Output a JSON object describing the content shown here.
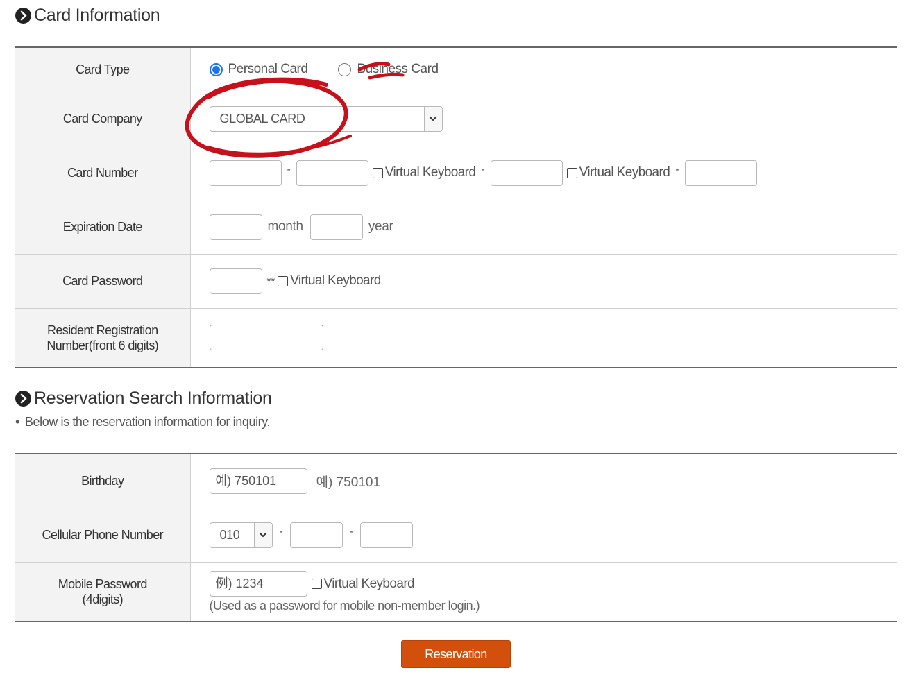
{
  "card_section": {
    "title": "Card Information",
    "card_type": {
      "label": "Card Type",
      "options": [
        "Personal Card",
        "Business Card"
      ],
      "selected": "Personal Card"
    },
    "card_company": {
      "label": "Card Company",
      "value": "GLOBAL CARD"
    },
    "card_number": {
      "label": "Card Number",
      "separator": "-",
      "virtual_keyboard_label": "Virtual Keyboard"
    },
    "expiration": {
      "label": "Expiration Date",
      "month_unit": "month",
      "year_unit": "year"
    },
    "password": {
      "label": "Card Password",
      "suffix": "**",
      "virtual_keyboard_label": "Virtual Keyboard"
    },
    "resident": {
      "label_line1": "Resident Registration",
      "label_line2": "Number(front 6 digits)"
    }
  },
  "reservation_section": {
    "title": "Reservation Search Information",
    "note_bullet": "•",
    "note": "Below is the reservation information for inquiry.",
    "birthday": {
      "label": "Birthday",
      "placeholder": "예) 750101",
      "hint": "예) 750101"
    },
    "phone": {
      "label": "Cellular Phone Number",
      "prefix": "010",
      "separator": "-"
    },
    "mobile_password": {
      "label_line1": "Mobile Password",
      "label_line2": "(4digits)",
      "placeholder": "例) 1234",
      "virtual_keyboard_label": "Virtual Keyboard",
      "hint": "(Used as a password for mobile non-member login.)"
    }
  },
  "reservation_button": "Reservation",
  "colors": {
    "accent": "#d2500c",
    "annotation": "#c8101a",
    "radio_selected": "#1a73e8"
  },
  "icons": [
    "circle-chevron-right-icon",
    "chevron-down-icon",
    "checkbox-icon",
    "radio-icon"
  ]
}
